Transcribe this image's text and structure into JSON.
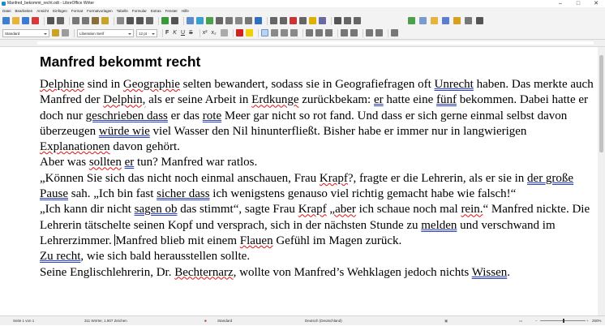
{
  "window": {
    "title": "Manfred_bekommt_recht.odt - LibreOffice Writer",
    "minimize": "–",
    "maximize": "□",
    "close": "✕"
  },
  "menu": [
    "Datei",
    "Bearbeiten",
    "Ansicht",
    "Einfügen",
    "Format",
    "Formatvorlagen",
    "Tabelle",
    "Formular",
    "Extras",
    "Fenster",
    "Hilfe"
  ],
  "toolbar1_icons": [
    "new-icon",
    "open-icon",
    "save-icon",
    "export-pdf-icon",
    "print-icon",
    "print-preview-icon",
    "cut-icon",
    "copy-icon",
    "paste-icon",
    "clone-formatting-icon",
    "clear-formatting-icon",
    "undo-icon",
    "redo-icon",
    "find-replace-icon",
    "spelling-icon",
    "formatting-marks-icon",
    "insert-table-icon",
    "insert-image-icon",
    "insert-chart-icon",
    "insert-textbox-icon",
    "insert-page-break-icon",
    "insert-field-icon",
    "insert-special-character-icon",
    "hyperlink-icon",
    "footnote-icon",
    "endnote-icon",
    "bookmark-icon",
    "cross-reference-icon",
    "comment-icon",
    "track-changes-icon",
    "insert-line-icon",
    "basic-shapes-icon",
    "draw-functions-icon"
  ],
  "toolbar1_colors": [
    "#3f7fd0",
    "#e8b33a",
    "#3a7bd5",
    "#d9383a",
    "#555",
    "#666",
    "#777",
    "#777",
    "#8a6d3b",
    "#c9a227",
    "#888",
    "#555",
    "#555",
    "#666",
    "#3a9a3a",
    "#555",
    "#5a8bd0",
    "#3aa0d0",
    "#4c9f4c",
    "#666",
    "#777",
    "#888",
    "#777",
    "#3070c0",
    "#666",
    "#666",
    "#c33",
    "#666",
    "#e0b000",
    "#6a6aa0",
    "#555",
    "#666",
    "#666"
  ],
  "right_toolbar_icons": [
    "navigator-icon",
    "styles-icon",
    "gallery-icon",
    "image-icon",
    "label-icon",
    "properties-icon",
    "sidebar-icon"
  ],
  "paragraph_style": "Standard",
  "font_name": "Liberation Serif",
  "font_size": "12 pt",
  "format_buttons": [
    "F",
    "K",
    "U",
    "S"
  ],
  "superscript": "x²",
  "subscript": "x₂",
  "heading": "Manfred bekommt recht",
  "paragraphs": [
    [
      {
        "t": "Delphine",
        "c": "sp"
      },
      {
        "t": " sind in "
      },
      {
        "t": "Geographie",
        "c": "sp"
      },
      {
        "t": " selten bewandert, sodass sie in Geografiefragen oft "
      },
      {
        "t": "Unrecht",
        "c": "gr"
      },
      {
        "t": " haben. Das merkte auch Manfred der "
      },
      {
        "t": "Delphin,",
        "c": "sp"
      },
      {
        "t": " als er seine Arbeit in "
      },
      {
        "t": "Erdkunge",
        "c": "sp"
      },
      {
        "t": " zurückbekam: "
      },
      {
        "t": "er",
        "c": "gr"
      },
      {
        "t": " hatte eine "
      },
      {
        "t": "fünf",
        "c": "gr"
      },
      {
        "t": " bekommen. Dabei hatte er doch nur "
      },
      {
        "t": "geschrieben dass",
        "c": "gr"
      },
      {
        "t": " er das "
      },
      {
        "t": "rote",
        "c": "gr"
      },
      {
        "t": " Meer gar nicht so rot fand. Und dass er sich gerne einmal selbst davon überzeugen "
      },
      {
        "t": "würde wie",
        "c": "gr"
      },
      {
        "t": " viel Wasser den Nil hinunterfließt. Bisher habe er immer nur in langwierigen "
      },
      {
        "t": "Explanationen",
        "c": "sp"
      },
      {
        "t": " davon gehört."
      }
    ],
    [
      {
        "t": "Aber was "
      },
      {
        "t": "sollten",
        "c": "sp"
      },
      {
        "t": " "
      },
      {
        "t": "er",
        "c": "gr"
      },
      {
        "t": " tun? Manfred war ratlos."
      }
    ],
    [
      {
        "t": "„Können Sie sich das nicht noch einmal anschauen, Frau "
      },
      {
        "t": "Krapf",
        "c": "sp"
      },
      {
        "t": "?, fragte er die Lehrerin, als er sie in "
      },
      {
        "t": "der große Pause",
        "c": "gr"
      },
      {
        "t": " sah. „Ich bin fast "
      },
      {
        "t": "sicher dass",
        "c": "gr"
      },
      {
        "t": " ich wenigstens genauso viel richtig gemacht habe wie falsch!“"
      }
    ],
    [
      {
        "t": "„Ich kann dir nicht "
      },
      {
        "t": "sagen ob",
        "c": "gr"
      },
      {
        "t": " das stimmt“, sagte Frau "
      },
      {
        "t": "Krapf",
        "c": "sp"
      },
      {
        "t": " "
      },
      {
        "t": "„aber",
        "c": "sp"
      },
      {
        "t": " ich schaue noch mal "
      },
      {
        "t": "rein.",
        "c": "sp"
      },
      {
        "t": "“ Manfred nickte. Die Lehrerin tätschelte seinen Kopf und versprach, sich in der nächsten Stunde zu "
      },
      {
        "t": "melden",
        "c": "gr"
      },
      {
        "t": " und verschwand im Lehrerzimmer. "
      },
      {
        "t": "",
        "c": "cursor"
      },
      {
        "t": "Manfred blieb mit einem "
      },
      {
        "t": "Flauen",
        "c": "sp"
      },
      {
        "t": " Gefühl im Magen zurück."
      }
    ],
    [
      {
        "t": "Zu recht",
        "c": "gr"
      },
      {
        "t": ", wie sich bald herausstellen sollte."
      }
    ],
    [
      {
        "t": "Seine Englischlehrerin, Dr. "
      },
      {
        "t": "Bechternarz",
        "c": "sp"
      },
      {
        "t": ", wollte von Manfred’s Wehklagen jedoch nichts "
      },
      {
        "t": "Wissen",
        "c": "gr"
      },
      {
        "t": "."
      }
    ]
  ],
  "status": {
    "page": "Seite 1 von 1",
    "words": "311 Wörter, 1.907 Zeichen",
    "page_style": "Standard",
    "language": "Deutsch (Deutschland)",
    "zoom": "250%"
  }
}
